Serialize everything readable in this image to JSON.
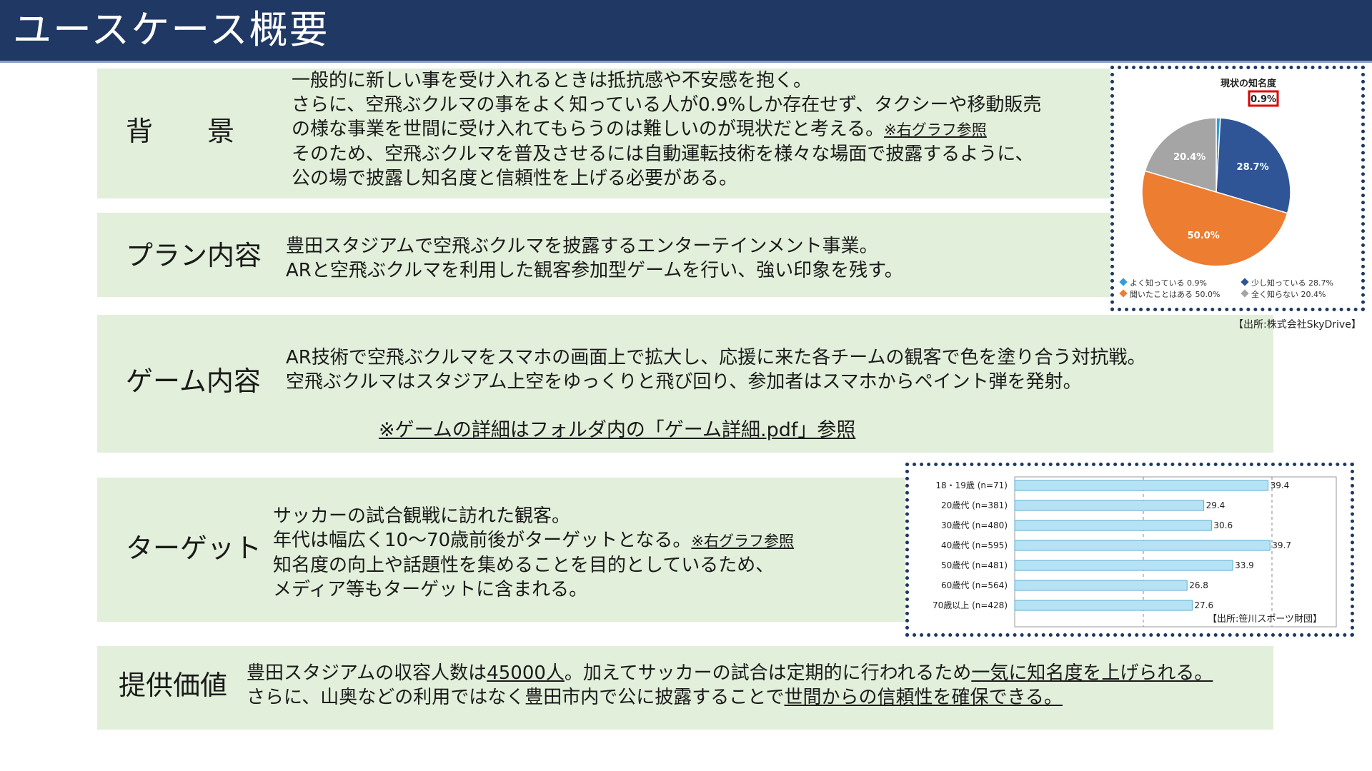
{
  "header": {
    "title": "ユースケース概要"
  },
  "sections": {
    "background": {
      "label": "背　　景",
      "lines": [
        "一般的に新しい事を受け入れるときは抵抗感や不安感を抱く。",
        "さらに、空飛ぶクルマの事をよく知っている人が0.9%しか存在せず、タクシーや移動販売",
        "の様な事業を世間に受け入れてもらうのは難しいのが現状だと考える。",
        "そのため、空飛ぶクルマを普及させるには自動運転技術を様々な場面で披露するように、",
        "公の場で披露し知名度と信頼性を上げる必要がある。"
      ],
      "note": "※右グラフ参照"
    },
    "plan": {
      "label": "プラン内容",
      "lines": [
        "豊田スタジアムで空飛ぶクルマを披露するエンターテインメント事業。",
        "ARと空飛ぶクルマを利用した観客参加型ゲームを行い、強い印象を残す。"
      ]
    },
    "game": {
      "label": "ゲーム内容",
      "lines": [
        "AR技術で空飛ぶクルマをスマホの画面上で拡大し、応援に来た各チームの観客で色を塗り合う対抗戦。",
        "空飛ぶクルマはスタジアム上空をゆっくりと飛び回り、参加者はスマホからペイント弾を発射。"
      ],
      "note": "※ゲームの詳細はフォルダ内の「ゲーム詳細.pdf」参照"
    },
    "target": {
      "label": "ターゲット",
      "lines": [
        "サッカーの試合観戦に訪れた観客。",
        "年代は幅広く10～70歳前後がターゲットとなる。",
        "知名度の向上や話題性を集めることを目的としているため、",
        "メディア等もターゲットに含まれる。"
      ],
      "note": "※右グラフ参照"
    },
    "value": {
      "label": "提供価値",
      "line1_a": "豊田スタジアムの収容人数は",
      "line1_b": "45000人",
      "line1_c": "。加えてサッカーの試合は定期的に行われるため",
      "line1_d": "一気に知名度を上げられる。",
      "line2_a": "さらに、山奥などの利用ではなく豊田市内で公に披露することで",
      "line2_b": "世間からの信頼性を確保できる。"
    }
  },
  "chart_data": [
    {
      "type": "pie",
      "title": "現状の知名度",
      "highlight": "0.9%",
      "slices": [
        {
          "label": "よく知っている",
          "value": 0.9,
          "legend": "よく知っている 0.9%",
          "color": "#2e9fd8"
        },
        {
          "label": "少し知っている",
          "value": 28.7,
          "legend": "少し知っている 28.7%",
          "color": "#2f5597",
          "data_label": "28.7%"
        },
        {
          "label": "聞いたことはある",
          "value": 50.0,
          "legend": "聞いたことはある 50.0%",
          "color": "#ed7d31",
          "data_label": "50.0%"
        },
        {
          "label": "全く知らない",
          "value": 20.4,
          "legend": "全く知らない 20.4%",
          "color": "#a5a5a5",
          "data_label": "20.4%"
        }
      ],
      "source": "【出所:株式会社SkyDrive】"
    },
    {
      "type": "bar",
      "orientation": "horizontal",
      "categories": [
        "18・19歳 (n=71)",
        "20歳代 (n=381)",
        "30歳代 (n=480)",
        "40歳代 (n=595)",
        "50歳代 (n=481)",
        "60歳代 (n=564)",
        "70歳以上 (n=428)"
      ],
      "values": [
        39.4,
        29.4,
        30.6,
        39.7,
        33.9,
        26.8,
        27.6
      ],
      "xlim": [
        0,
        50
      ],
      "bar_color": "#b5e3f5",
      "source": "【出所:笹川スポーツ財団】"
    }
  ]
}
